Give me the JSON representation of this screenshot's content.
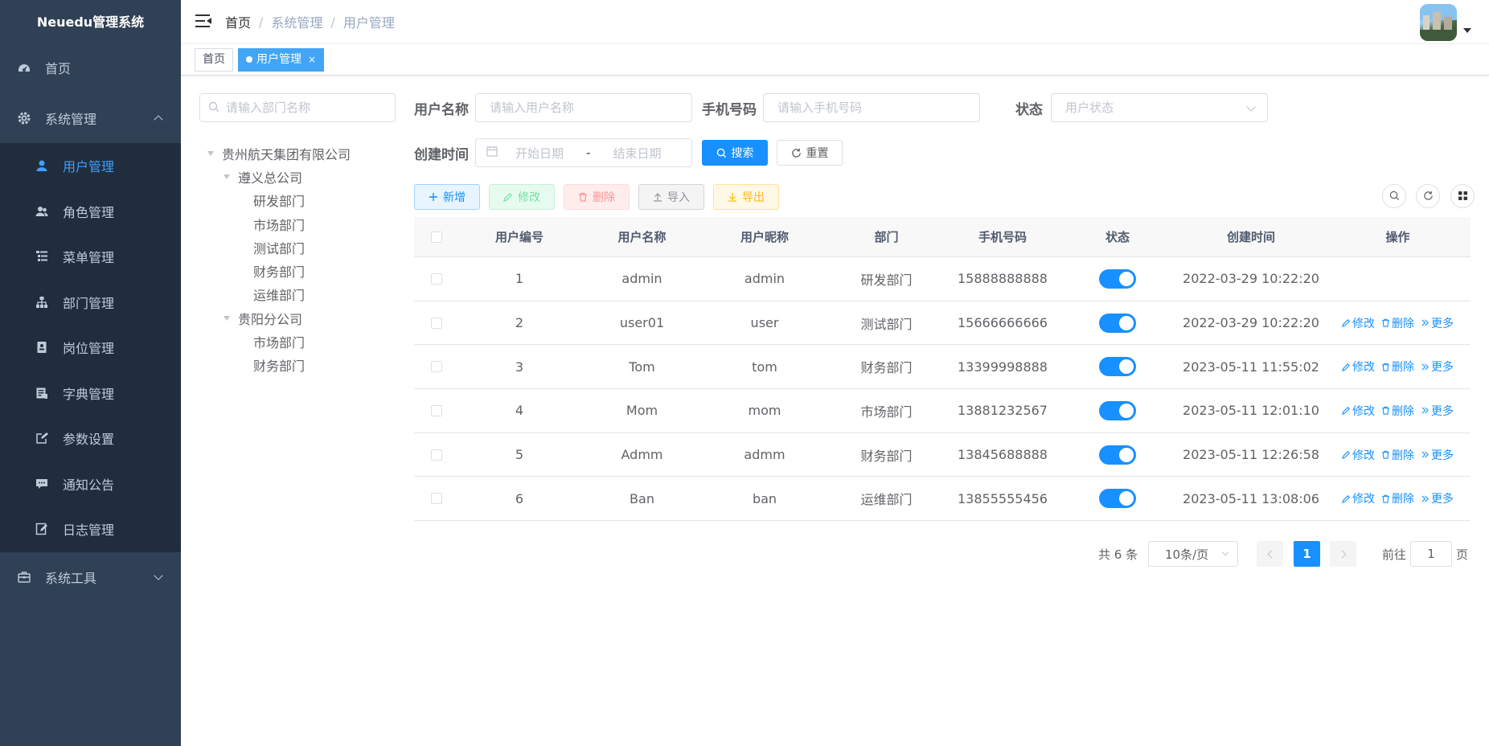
{
  "sidebar": {
    "logo": "Neuedu管理系统",
    "home": "首页",
    "system": "系统管理",
    "sub": [
      "用户管理",
      "角色管理",
      "菜单管理",
      "部门管理",
      "岗位管理",
      "字典管理",
      "参数设置",
      "通知公告",
      "日志管理"
    ],
    "tools": "系统工具"
  },
  "breadcrumb": [
    "首页",
    "系统管理",
    "用户管理"
  ],
  "tags": {
    "home": "首页",
    "active": "用户管理",
    "close": "×"
  },
  "tree": {
    "placeholder": "请输入部门名称",
    "root": "贵州航天集团有限公司",
    "c1": "遵义总公司",
    "c1_children": [
      "研发部门",
      "市场部门",
      "测试部门",
      "财务部门",
      "运维部门"
    ],
    "c2": "贵阳分公司",
    "c2_children": [
      "市场部门",
      "财务部门"
    ]
  },
  "form": {
    "username_label": "用户名称",
    "username_ph": "请输入用户名称",
    "phone_label": "手机号码",
    "phone_ph": "请输入手机号码",
    "status_label": "状态",
    "status_ph": "用户状态",
    "time_label": "创建时间",
    "start_ph": "开始日期",
    "range_sep": "-",
    "end_ph": "结束日期",
    "search": "搜索",
    "reset": "重置"
  },
  "toolbar": {
    "add": "新增",
    "edit": "修改",
    "del": "删除",
    "import": "导入",
    "export": "导出"
  },
  "table": {
    "headers": [
      "用户编号",
      "用户名称",
      "用户昵称",
      "部门",
      "手机号码",
      "状态",
      "创建时间",
      "操作"
    ],
    "ops": {
      "edit": "修改",
      "del": "删除",
      "more": "更多"
    },
    "rows": [
      {
        "id": "1",
        "name": "admin",
        "nick": "admin",
        "dept": "研发部门",
        "phone": "15888888888",
        "time": "2022-03-29 10:22:20"
      },
      {
        "id": "2",
        "name": "user01",
        "nick": "user",
        "dept": "测试部门",
        "phone": "15666666666",
        "time": "2022-03-29 10:22:20"
      },
      {
        "id": "3",
        "name": "Tom",
        "nick": "tom",
        "dept": "财务部门",
        "phone": "13399998888",
        "time": "2023-05-11 11:55:02"
      },
      {
        "id": "4",
        "name": "Mom",
        "nick": "mom",
        "dept": "市场部门",
        "phone": "13881232567",
        "time": "2023-05-11 12:01:10"
      },
      {
        "id": "5",
        "name": "Admm",
        "nick": "admm",
        "dept": "财务部门",
        "phone": "13845688888",
        "time": "2023-05-11 12:26:58"
      },
      {
        "id": "6",
        "name": "Ban",
        "nick": "ban",
        "dept": "运维部门",
        "phone": "13855555456",
        "time": "2023-05-11 13:08:06"
      }
    ]
  },
  "pagination": {
    "total": "共 6 条",
    "size": "10条/页",
    "page": "1",
    "goto": "前往",
    "goto_value": "1",
    "unit": "页"
  },
  "colors": {
    "sidebar": "#304156",
    "submenu": "#1f2d3d",
    "primary": "#1890ff",
    "active_tag": "#42a5f5"
  }
}
